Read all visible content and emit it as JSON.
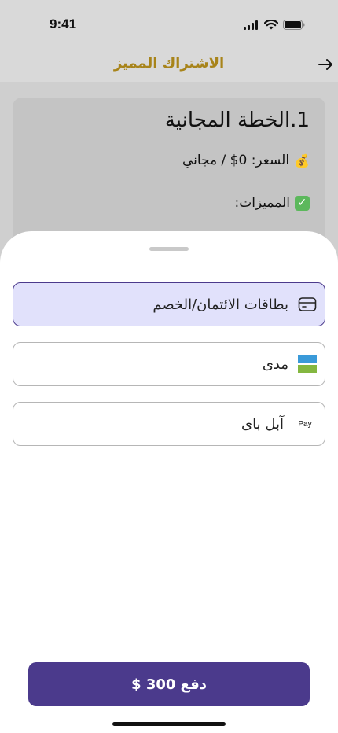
{
  "status": {
    "time": "9:41"
  },
  "header": {
    "title": "الاشتراك المميز"
  },
  "plan": {
    "title": "1.الخطة المجانية",
    "price": "السعر: 0$ / مجاني",
    "features_label": "المميزات:"
  },
  "payment_options": [
    {
      "label": "بطاقات الائتمان/الخصم",
      "icon": "credit-card-icon",
      "selected": true
    },
    {
      "label": "مدى",
      "icon": "mada-icon",
      "selected": false
    },
    {
      "label": "آبل باى",
      "icon": "apple-pay-icon",
      "selected": false
    }
  ],
  "pay_button": {
    "label": "دفع 300 $"
  },
  "colors": {
    "accent": "#4b3a8c",
    "header_title": "#a8841a",
    "selected_bg": "#e1e1fb"
  }
}
